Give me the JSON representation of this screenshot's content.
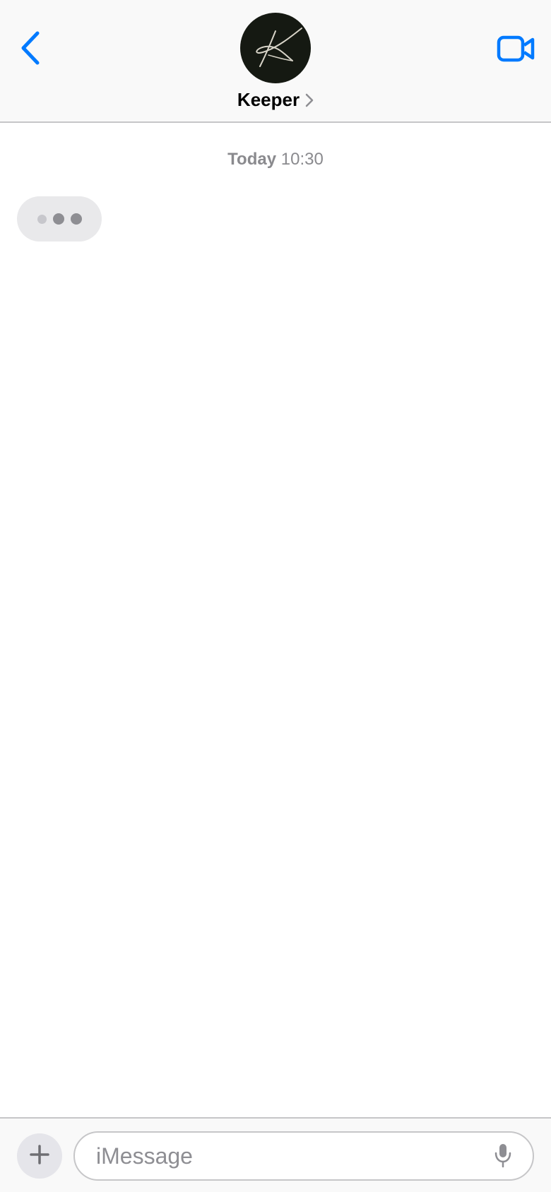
{
  "header": {
    "contact_name": "Keeper",
    "back_icon": "chevron-left-icon",
    "video_icon": "video-camera-icon",
    "avatar_icon": "signature-k-logo"
  },
  "conversation": {
    "timestamp_day": "Today",
    "timestamp_time": "10:30",
    "typing_indicator_icon": "typing-dots-icon"
  },
  "composer": {
    "placeholder": "iMessage",
    "value": "",
    "plus_icon": "plus-icon",
    "mic_icon": "microphone-icon"
  },
  "colors": {
    "accent": "#007aff",
    "header_bg": "#f9f9f9",
    "avatar_bg": "#151912",
    "bubble_bg": "#e9e9eb",
    "secondary_text": "#8a8a8e"
  }
}
